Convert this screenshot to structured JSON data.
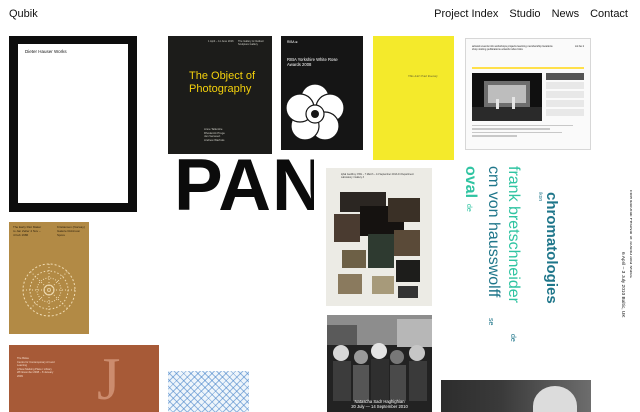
{
  "brand": "Qubik",
  "nav": [
    "Project Index",
    "Studio",
    "News",
    "Contact"
  ],
  "tiles": {
    "frame_book": {
      "text": "Dieter Hauser Works"
    },
    "photo_book": {
      "meta_left": "1 April – 11 June 2016",
      "meta_right": "The Gallery & Outdoor Sculpture Gallery",
      "title": "The Object of Photography",
      "names": "Anne Tallentire\nRhoderick Proge\nJan Verwoert\nAndrew Warhols"
    },
    "riba": {
      "logo": "RIBA ⊕",
      "text": "RIBA Yorkshire White Rose Awards 2008"
    },
    "yellow_book": {
      "text": "This Ain't Paul Rooney"
    },
    "website": {
      "head": "artwork events info workshops projects learning membership locations shop visiting publications artwork index links",
      "logo": "mk be it"
    },
    "pan": {
      "word": "PAN"
    },
    "collage": {
      "head": "Iqbal Geoffrey: PAN – 7 March – 14 September 2013 Art Department Laboratory / Gallery 3"
    },
    "chromatologies": {
      "title": "chromatologies",
      "artist1": "frank bretschneider",
      "artist1_suffix": "de",
      "artist2": "cm von hausswolff",
      "artist2_suffix": "se",
      "artist3": "oval",
      "artist3_suffix": "de",
      "small_left": "ikon",
      "festival": "International Festival of Sound and Music",
      "dates": "6 April – 3 July 2010 Baltic, UK"
    },
    "crochet": {
      "text_left": "The Early Riot Maker to Jan Zeller 4 Nov – 4 Feb 1986",
      "text_right": "Kristiansen (Norway) Galerie Robinson Spore"
    },
    "rust": {
      "text": "The Bolsa\nCentre for Contemporary Art and Learning\nA New Marking Place / Library\n28 November 2008 – 8 January 2009",
      "ornament": "J"
    },
    "bw_poster": {
      "caption": "Natascha Sadr Haghighian\n20 July — 14 September 2010"
    }
  }
}
